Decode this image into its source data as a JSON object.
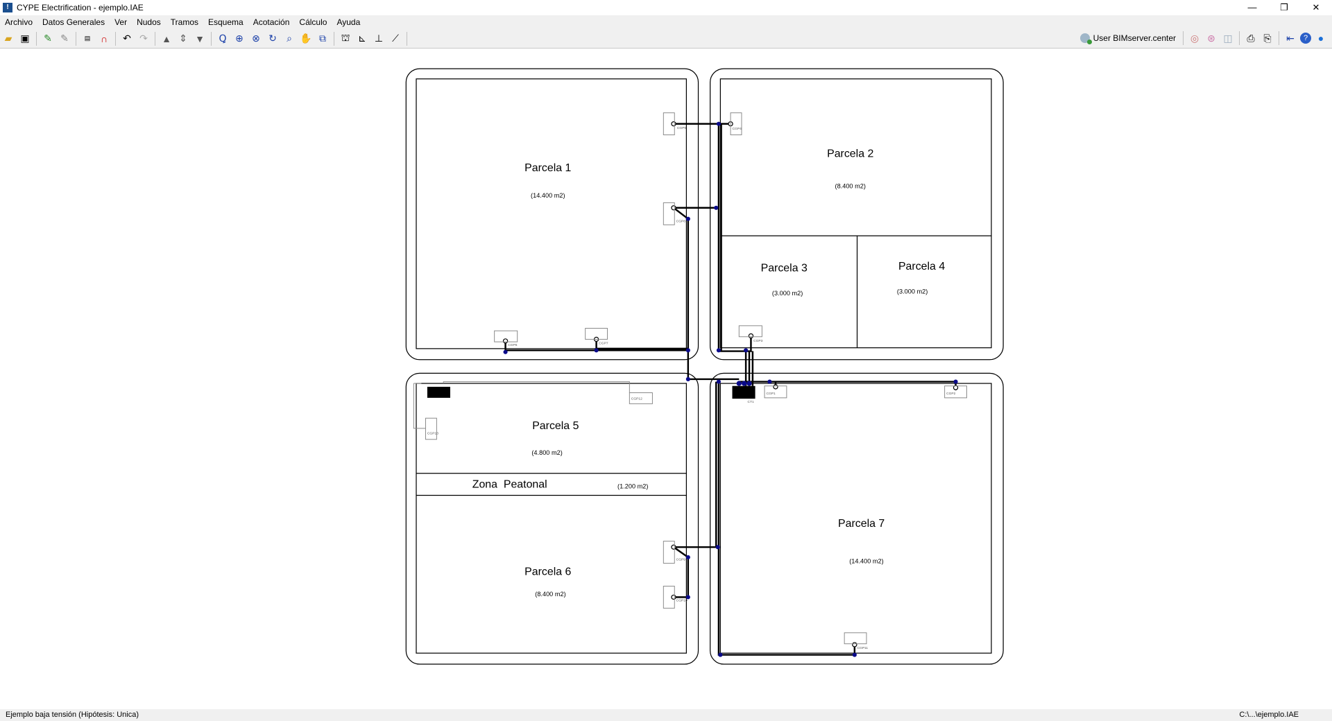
{
  "window": {
    "title": "CYPE Electrification - ejemplo.IAE",
    "minimize": "—",
    "restore": "❐",
    "close": "✕"
  },
  "menu": [
    "Archivo",
    "Datos Generales",
    "Ver",
    "Nudos",
    "Tramos",
    "Esquema",
    "Acotación",
    "Cálculo",
    "Ayuda"
  ],
  "toolbar": {
    "user_label": "User BIMserver.center"
  },
  "plan": {
    "parcels": [
      {
        "name": "Parcela 1",
        "area": "(14.400 m2)"
      },
      {
        "name": "Parcela 2",
        "area": "(8.400 m2)"
      },
      {
        "name": "Parcela 3",
        "area": "(3.000 m2)"
      },
      {
        "name": "Parcela 4",
        "area": "(3.000 m2)"
      },
      {
        "name": "Parcela 5",
        "area": "(4.800 m2)"
      },
      {
        "name": "Zona  Peatonal",
        "area": "(1.200 m2)"
      },
      {
        "name": "Parcela 6",
        "area": "(8.400 m2)"
      },
      {
        "name": "Parcela 7",
        "area": "(14.400 m2)"
      }
    ],
    "boxes": [
      "CGP1",
      "CGP2",
      "CGP3",
      "CGP4",
      "CGP5",
      "CGP6",
      "CGP7",
      "CGP8",
      "CGP9",
      "CGP10",
      "CGP11",
      "CGP12",
      "CGP13",
      "CT1"
    ]
  },
  "status": {
    "left": "Ejemplo baja tensión (Hipótesis: Unica)",
    "right": "C:\\...\\ejemplo.IAE"
  }
}
